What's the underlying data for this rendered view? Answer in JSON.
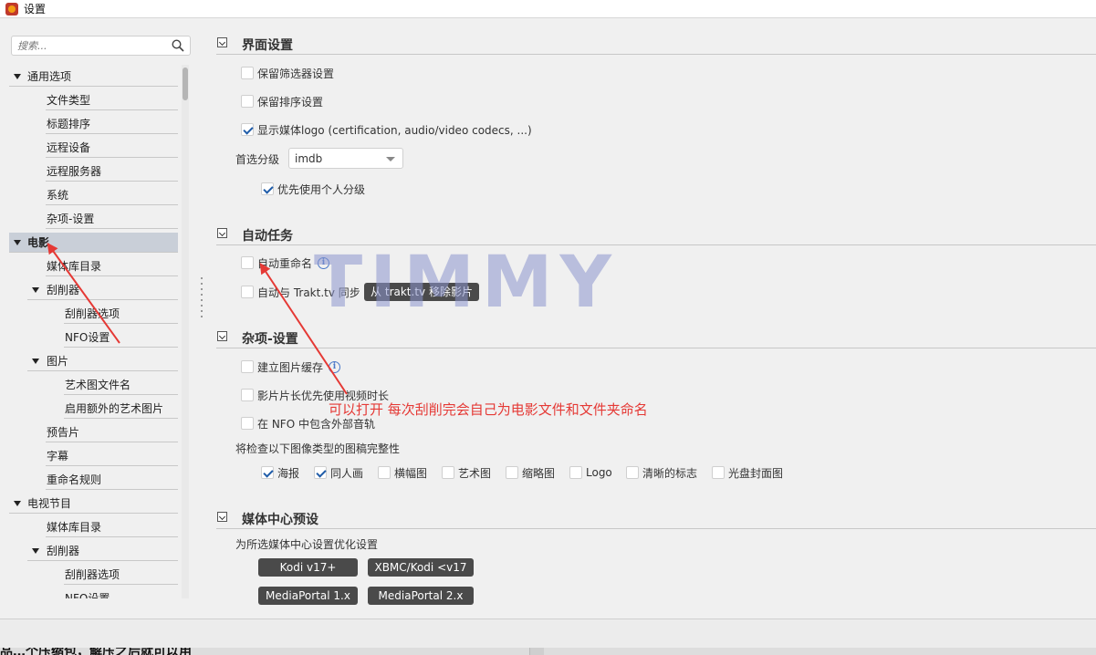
{
  "window": {
    "title": "设置"
  },
  "search": {
    "placeholder": "搜索..."
  },
  "tree": {
    "general": {
      "label": "通用选项",
      "children": [
        "文件类型",
        "标题排序",
        "远程设备",
        "远程服务器",
        "系统",
        "杂项-设置"
      ]
    },
    "movie": {
      "label": "电影",
      "library": "媒体库目录",
      "scraper": "刮削器",
      "scraper_children": [
        "刮削器选项",
        "NFO设置"
      ],
      "images": "图片",
      "images_children": [
        "艺术图文件名",
        "启用额外的艺术图片"
      ],
      "trailer": "预告片",
      "subtitle": "字幕",
      "rename": "重命名规则"
    },
    "tv": {
      "label": "电视节目",
      "library": "媒体库目录",
      "scraper": "刮削器",
      "scraper_children": [
        "刮削器选项",
        "NFO设置"
      ]
    }
  },
  "sections": {
    "ui": {
      "title": "界面设置",
      "keep_filter": "保留筛选器设置",
      "keep_sort": "保留排序设置",
      "show_logo": "显示媒体logo (certification, audio/video codecs, ...)",
      "rating_label": "首选分级",
      "rating_value": "imdb",
      "personal_rating": "优先使用个人分级"
    },
    "auto": {
      "title": "自动任务",
      "auto_rename": "自动重命名",
      "trakt_sync": "自动与 Trakt.tv 同步",
      "trakt_button": "从 trakt.tv 移除影片"
    },
    "misc": {
      "title": "杂项-设置",
      "image_cache": "建立图片缓存",
      "runtime_from_video": "影片片长优先使用视频时长",
      "nfo_external_audio": "在 NFO 中包含外部音轨",
      "check_label": "将检查以下图像类型的图稿完整性",
      "image_types": [
        {
          "label": "海报",
          "checked": true
        },
        {
          "label": "同人画",
          "checked": true
        },
        {
          "label": "横幅图",
          "checked": false
        },
        {
          "label": "艺术图",
          "checked": false
        },
        {
          "label": "缩略图",
          "checked": false
        },
        {
          "label": "Logo",
          "checked": false
        },
        {
          "label": "清晰的标志",
          "checked": false
        },
        {
          "label": "光盘封面图",
          "checked": false
        }
      ]
    },
    "media_center": {
      "title": "媒体中心预设",
      "description": "为所选媒体中心设置优化设置",
      "buttons": [
        "Kodi v17+",
        "XBMC/Kodi <v17",
        "MediaPortal 1.x",
        "MediaPortal 2.x"
      ]
    }
  },
  "overlay": {
    "watermark": "TIMMY",
    "annotation": "可以打开 每次刮削完会自己为电影文件和文件夹命名",
    "arrow_color": "#e53935"
  },
  "bottom": {
    "text": "品…个压缩包，解压之后就可以用"
  }
}
